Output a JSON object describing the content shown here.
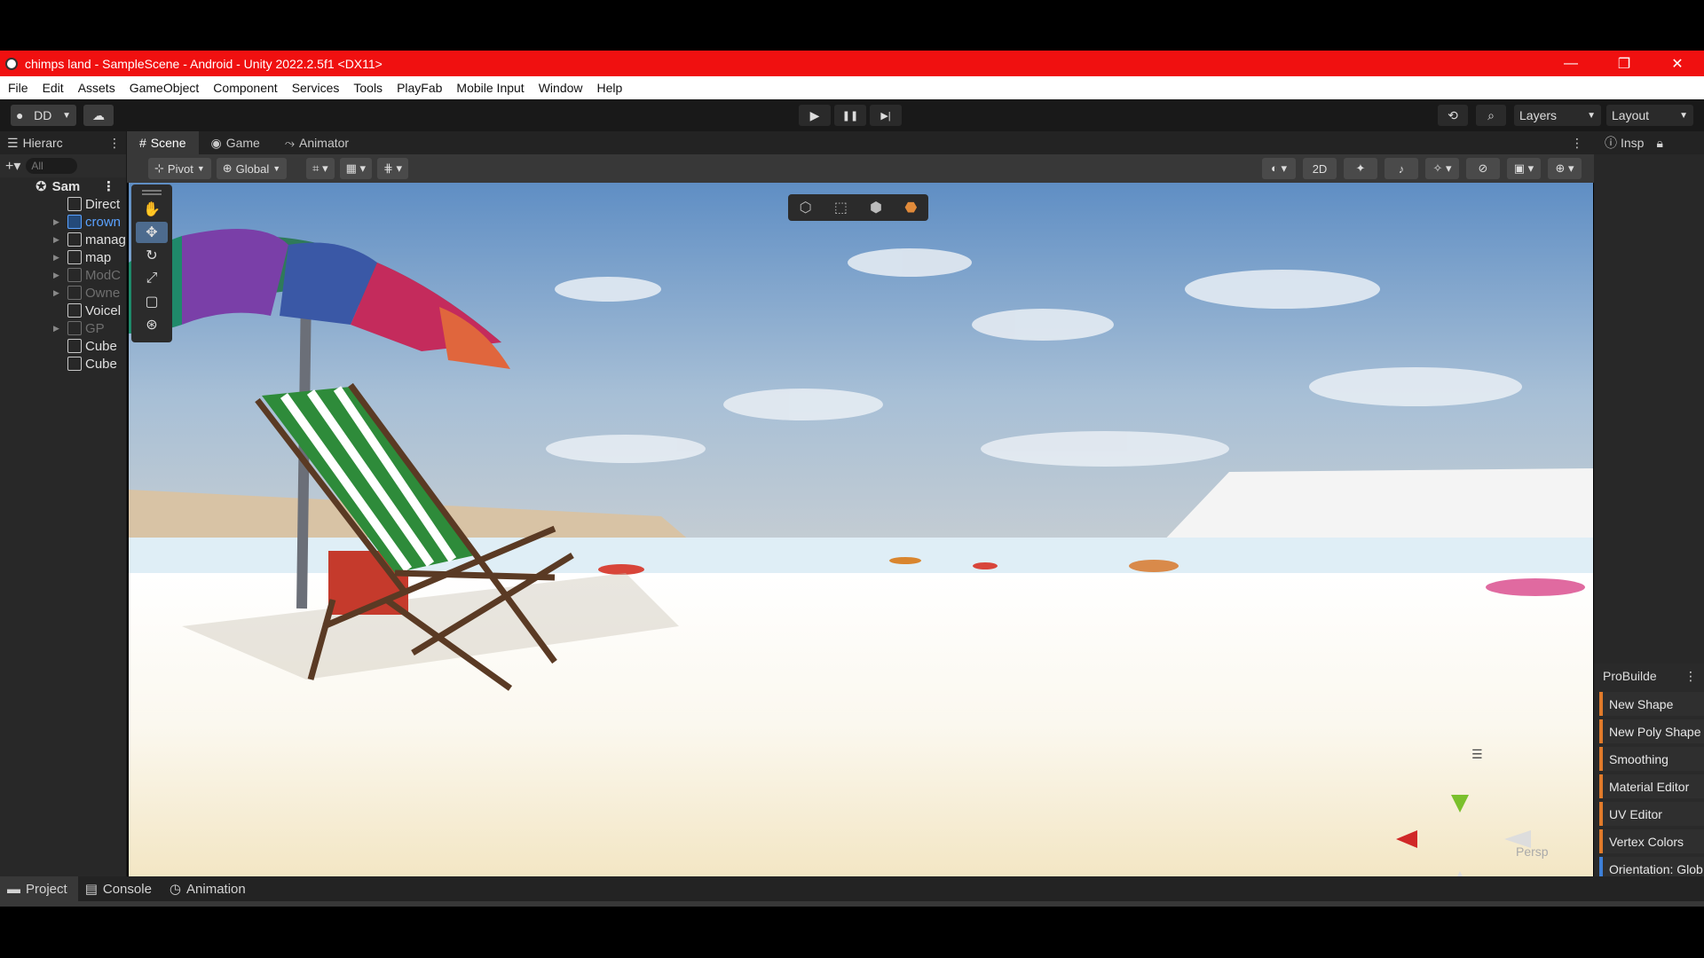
{
  "window": {
    "title": "chimps land - SampleScene - Android - Unity 2022.2.5f1 <DX11>",
    "minimize_icon": "—",
    "restore_icon": "❐",
    "close_icon": "✕"
  },
  "menu": [
    "File",
    "Edit",
    "Assets",
    "GameObject",
    "Component",
    "Services",
    "Tools",
    "PlayFab",
    "Mobile Input",
    "Window",
    "Help"
  ],
  "toolbar": {
    "account": "DD",
    "play": "▶",
    "pause": "❚❚",
    "step": "▶|",
    "layers": "Layers",
    "layout": "Layout"
  },
  "hierarchy": {
    "tab": "Hierarc",
    "search_placeholder": "All",
    "scene": "Sam",
    "items": [
      {
        "label": "Direct",
        "arrow": ""
      },
      {
        "label": "crown",
        "arrow": "▶"
      },
      {
        "label": "manag",
        "arrow": "▶"
      },
      {
        "label": "map",
        "arrow": "▶"
      },
      {
        "label": "ModC",
        "arrow": "▶"
      },
      {
        "label": "Owne",
        "arrow": "▶"
      },
      {
        "label": "Voicel",
        "arrow": ""
      },
      {
        "label": "GP",
        "arrow": "▶"
      },
      {
        "label": "Cube",
        "arrow": ""
      },
      {
        "label": "Cube",
        "arrow": ""
      }
    ]
  },
  "scene_tabs": [
    "Scene",
    "Game",
    "Animator"
  ],
  "scene_toolbar": {
    "pivot": "Pivot",
    "global": "Global",
    "mode_2d": "2D",
    "persp": "Persp"
  },
  "inspector": {
    "tab": "Insp",
    "probuilder_title": "ProBuilde",
    "probuilder_items": [
      "New Shape",
      "New Poly Shape",
      "Smoothing",
      "Material Editor",
      "UV Editor",
      "Vertex Colors",
      "Orientation: Glob"
    ]
  },
  "bottom_tabs": [
    "Project",
    "Console",
    "Animation"
  ]
}
